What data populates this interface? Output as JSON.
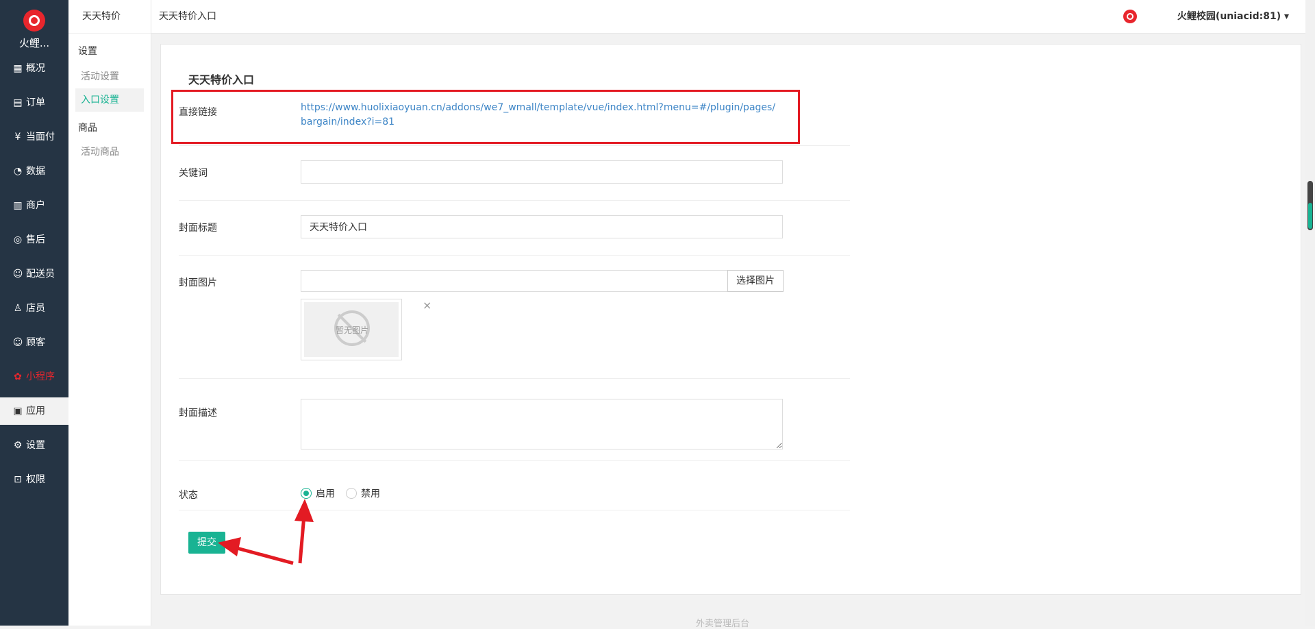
{
  "brand": {
    "name": "火鲤..."
  },
  "leftnav": {
    "items": [
      {
        "label": "概况",
        "icon": "dashboard-icon",
        "glyph": "▦"
      },
      {
        "label": "订单",
        "icon": "order-icon",
        "glyph": "▤"
      },
      {
        "label": "当面付",
        "icon": "yuan-icon",
        "glyph": "¥"
      },
      {
        "label": "数据",
        "icon": "chart-icon",
        "glyph": "◔"
      },
      {
        "label": "商户",
        "icon": "store-icon",
        "glyph": "▥"
      },
      {
        "label": "售后",
        "icon": "headset-icon",
        "glyph": "◎"
      },
      {
        "label": "配送员",
        "icon": "courier-icon",
        "glyph": "☺"
      },
      {
        "label": "店员",
        "icon": "clerk-icon",
        "glyph": "♙"
      },
      {
        "label": "顾客",
        "icon": "customer-icon",
        "glyph": "☺"
      },
      {
        "label": "小程序",
        "icon": "miniprogram-icon",
        "glyph": "✿"
      },
      {
        "label": "应用",
        "icon": "apps-icon",
        "glyph": "▣"
      },
      {
        "label": "设置",
        "icon": "gear-icon",
        "glyph": "⚙"
      },
      {
        "label": "权限",
        "icon": "lock-icon",
        "glyph": "⊡"
      }
    ]
  },
  "subnav": {
    "title": "天天特价",
    "group_settings": "设置",
    "item_activity_settings": "活动设置",
    "item_entry_settings": "入口设置",
    "group_goods": "商品",
    "item_activity_goods": "活动商品"
  },
  "header": {
    "breadcrumb": "天天特价入口",
    "user": "火鲤校园(uniacid:81) ▾"
  },
  "form": {
    "title": "天天特价入口",
    "direct_link_label": "直接链接",
    "direct_link_url": "https://www.huolixiaoyuan.cn/addons/we7_wmall/template/vue/index.html?menu=#/plugin/pages/bargain/index?i=81",
    "keyword_label": "关键词",
    "keyword_value": "",
    "cover_title_label": "封面标题",
    "cover_title_value": "天天特价入口",
    "cover_image_label": "封面图片",
    "cover_image_value": "",
    "choose_image_button": "选择图片",
    "no_image_text": "暂无图片",
    "remove_image": "×",
    "cover_desc_label": "封面描述",
    "cover_desc_value": "",
    "status_label": "状态",
    "status_enable": "启用",
    "status_disable": "禁用",
    "submit": "提交"
  },
  "footer": {
    "text": "外卖管理后台"
  },
  "colors": {
    "sidebar": "#253444",
    "accent": "#19b393",
    "highlight": "#e31b23",
    "link": "#3d85c6"
  }
}
